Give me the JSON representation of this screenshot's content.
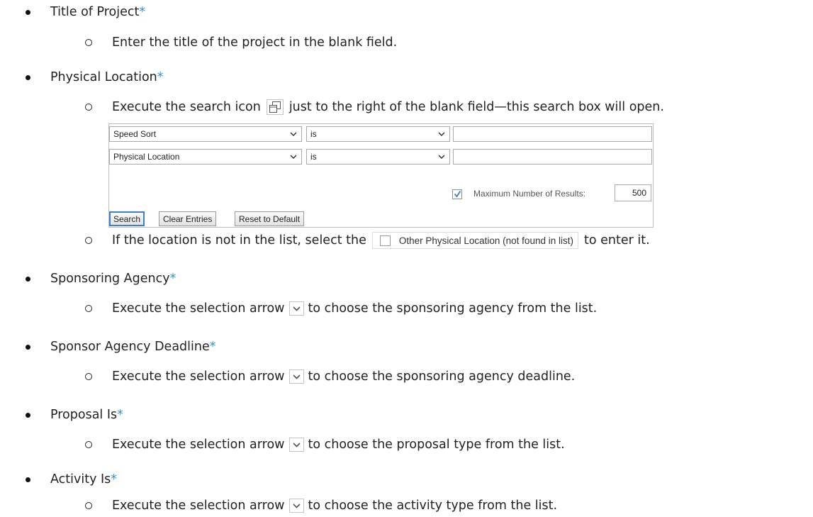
{
  "items": [
    {
      "label": "Title of Project",
      "star": "*",
      "sub": "Enter the title of the project in the blank field."
    },
    {
      "label": "Physical Location",
      "star": "*",
      "sub_before": "Execute the search icon",
      "sub_after": "just to the right of the blank field—this search box will open.",
      "sub2_before": "If the location is not in the list, select the",
      "sub2_after": "to enter it."
    },
    {
      "label": "Sponsoring Agency",
      "star": "*",
      "sub_before": "Execute the selection arrow",
      "sub_after": "to choose the sponsoring agency from the list."
    },
    {
      "label": "Sponsor Agency Deadline",
      "star": "*",
      "sub_before": "Execute the selection arrow",
      "sub_after": "to choose the sponsoring agency deadline."
    },
    {
      "label": "Proposal Is",
      "star": "*",
      "sub_before": "Execute the selection arrow",
      "sub_after": "to choose the proposal type from the list."
    },
    {
      "label": "Activity Is",
      "star": "*",
      "sub_before": "Execute the selection arrow",
      "sub_after": "to choose the activity type from the list."
    }
  ],
  "search_dialog": {
    "row1": {
      "field": "Speed Sort",
      "operator": "is",
      "value": ""
    },
    "row2": {
      "field": "Physical Location",
      "operator": "is",
      "value": ""
    },
    "max_results_checked": true,
    "max_results_label": "Maximum Number of Results:",
    "max_results_value": "500",
    "buttons": {
      "search": "Search",
      "clear": "Clear Entries",
      "reset": "Reset to Default"
    }
  },
  "other_location_label": "Other Physical Location (not found in list)",
  "colors": {
    "required_star": "#2b95c9",
    "primary_button_border": "#3d82c9",
    "checkbox_tick": "#3a7fc4"
  },
  "icons": {
    "popup": "popup-window-icon",
    "select": "dropdown-arrow-icon"
  }
}
